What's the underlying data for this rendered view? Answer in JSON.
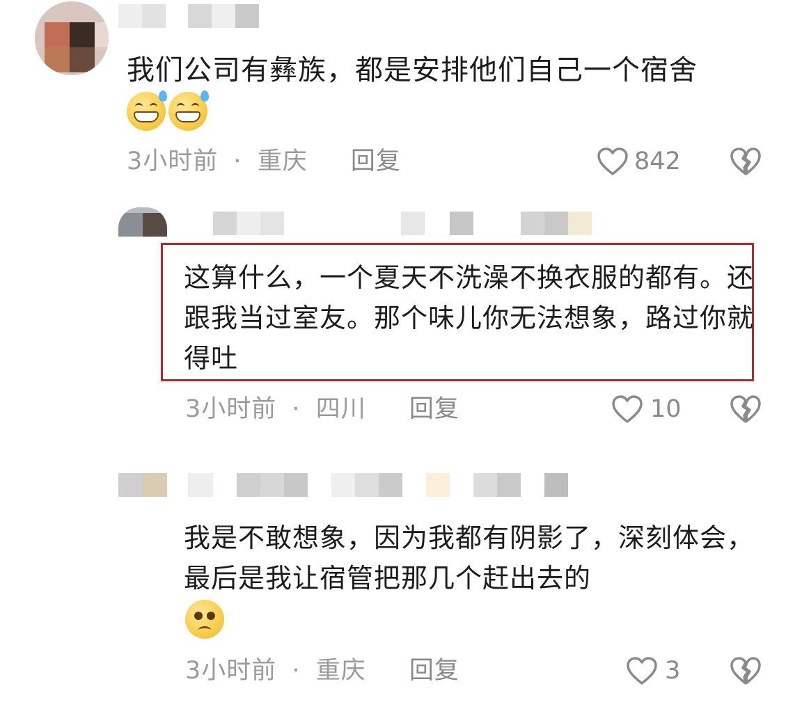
{
  "comments": [
    {
      "text": "我们公司有彝族，都是安排他们自己一个宿舍",
      "time": "3小时前",
      "separator": "·",
      "location": "重庆",
      "reply_label": "回复",
      "likes": "842",
      "emoji": [
        "grinning-sweat-emoji",
        "grinning-sweat-emoji"
      ]
    },
    {
      "text": "这算什么，一个夏天不洗澡不换衣服的都有。还跟我当过室友。那个味儿你无法想象，路过你就得吐",
      "time": "3小时前",
      "separator": "·",
      "location": "四川",
      "reply_label": "回复",
      "likes": "10",
      "highlighted": true
    },
    {
      "text": "我是不敢想象，因为我都有阴影了，深刻体会，最后是我让宿管把那几个赶出去的",
      "time": "3小时前",
      "separator": "·",
      "location": "重庆",
      "reply_label": "回复",
      "likes": "3",
      "emoji": [
        "pleading-face-emoji"
      ]
    }
  ],
  "colors": {
    "text": "#1c1c1c",
    "meta": "#9b9b9b",
    "highlight_border": "#b3282d",
    "icon": "#8a8a8a"
  }
}
